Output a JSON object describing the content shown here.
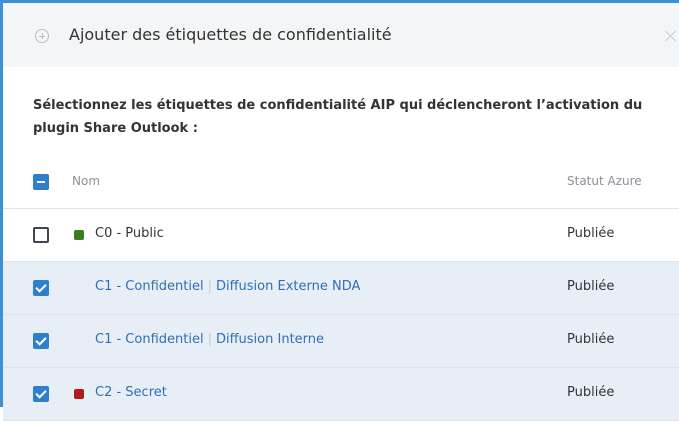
{
  "header": {
    "title": "Ajouter des étiquettes de confidentialité",
    "add_icon": "plus-circle-icon",
    "close_icon": "close-icon"
  },
  "instruction": "Sélectionnez les étiquettes de confidentialité AIP qui déclencheront l’activation du plugin Share Outlook :",
  "table": {
    "columns": {
      "name": "Nom",
      "status": "Statut Azure"
    },
    "select_all_state": "indeterminate",
    "rows": [
      {
        "parent": "C0 - Public",
        "separator": "",
        "child": "",
        "status": "Publiée",
        "checked": false,
        "color": "#3a7d1f"
      },
      {
        "parent": "C1 - Confidentiel",
        "separator": "|",
        "child": "Diffusion Externe NDA",
        "status": "Publiée",
        "checked": true,
        "color": ""
      },
      {
        "parent": "C1 - Confidentiel",
        "separator": "|",
        "child": "Diffusion Interne",
        "status": "Publiée",
        "checked": true,
        "color": ""
      },
      {
        "parent": "C2 - Secret",
        "separator": "",
        "child": "",
        "status": "Publiée",
        "checked": true,
        "color": "#b01a1a"
      }
    ]
  },
  "colors": {
    "accent": "#2f7fcf",
    "selected_row": "#e8eef6",
    "link": "#2f6fb7"
  }
}
